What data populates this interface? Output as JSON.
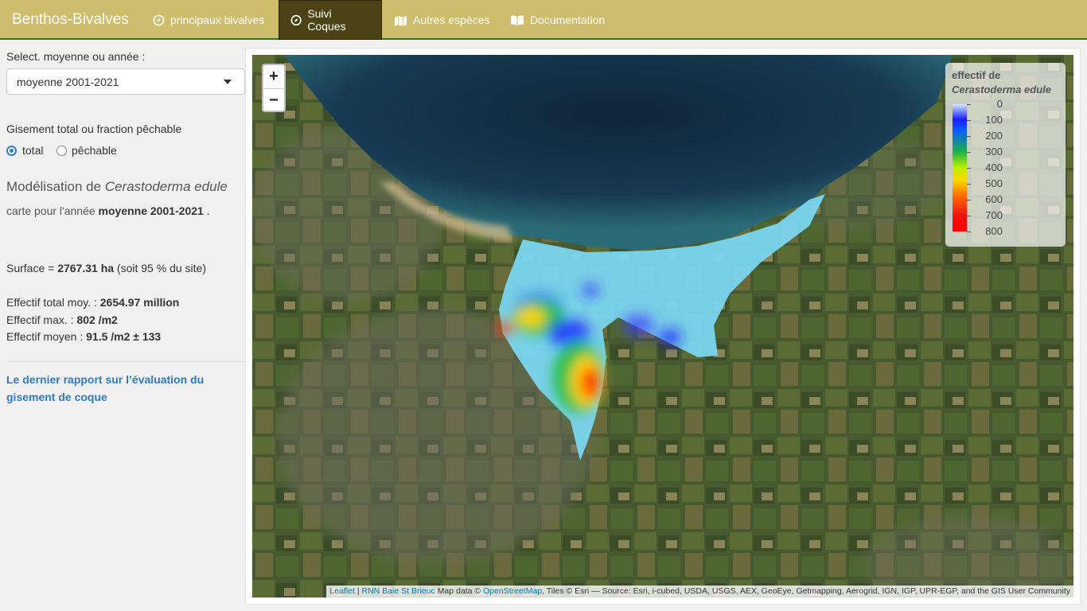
{
  "navbar": {
    "brand": "Benthos-Bivalves",
    "tabs": [
      {
        "label": "principaux bivalves",
        "icon": "compass-icon"
      },
      {
        "label": "Suivi Coques",
        "icon": "compass-icon",
        "active": true
      },
      {
        "label": "Autres espèces",
        "icon": "map-icon"
      },
      {
        "label": "Documentation",
        "icon": "book-open-icon"
      }
    ],
    "colors": {
      "bar": "#cdbd6c",
      "active": "#4b4216",
      "border": "#3f6b1d"
    }
  },
  "sidebar": {
    "select_label": "Select. moyenne ou année :",
    "select_value": "moyenne 2001-2021",
    "radio_label": "Gisement total ou fraction pêchable",
    "radio_options": [
      {
        "label": "total",
        "checked": true
      },
      {
        "label": "pêchable",
        "checked": false
      }
    ],
    "model_title_prefix": "Modélisation de ",
    "model_title_species": "Cerastoderma edule",
    "carte_prefix": "carte pour l'année ",
    "carte_year": "moyenne 2001-2021",
    "carte_suffix": " .",
    "surface_prefix": "Surface = ",
    "surface_value": "2767.31 ha",
    "surface_suffix": " (soit 95 % du site)",
    "stats": [
      {
        "label": "Effectif total moy. : ",
        "value": "2654.97 million"
      },
      {
        "label": "Effectif max. : ",
        "value": "802 /m2"
      },
      {
        "label": "Effectif moyen : ",
        "value": "91.5 /m2 ± 133"
      }
    ],
    "report_link": "Le dernier rapport sur l’évaluation du gisement de coque"
  },
  "map": {
    "zoom_in": "+",
    "zoom_out": "−",
    "legend": {
      "title_line1": "effectif de",
      "title_line2": "Cerastoderma edule",
      "ticks": [
        "0",
        "100",
        "200",
        "300",
        "400",
        "500",
        "600",
        "700",
        "800"
      ]
    },
    "attribution": {
      "leaflet": "Leaflet",
      "sep": " | ",
      "rnn": "RNN Baie St Brieuc",
      "mapdata": " Map data © ",
      "osm": "OpenStreetMap",
      "rest": ", Tiles © Esri — Source: Esri, i-cubed, USDA, USGS, AEX, GeoEye, Getmapping, Aerogrid, IGN, IGP, UPR-EGP, and the GIS User Community"
    }
  }
}
